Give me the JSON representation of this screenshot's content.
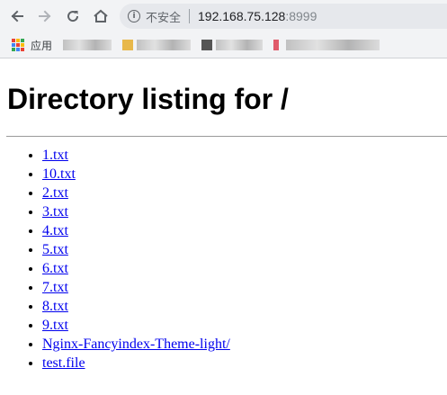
{
  "browser": {
    "address": {
      "security_label": "不安全",
      "host": "192.168.75.128",
      "port": ":8999"
    },
    "bookmarks_bar": {
      "apps_label": "应用"
    }
  },
  "page": {
    "heading": "Directory listing for /",
    "links": [
      "1.txt",
      "10.txt",
      "2.txt",
      "3.txt",
      "4.txt",
      "5.txt",
      "6.txt",
      "7.txt",
      "8.txt",
      "9.txt",
      "Nginx-Fancyindex-Theme-light/",
      "test.file"
    ]
  },
  "colors": {
    "link": "#0000ee",
    "chrome_bg": "#f2f3f5",
    "omnibox_bg": "#e6e8ec"
  },
  "icons": {
    "back": "back-arrow-icon",
    "forward": "forward-arrow-icon",
    "reload": "reload-icon",
    "home": "home-icon",
    "info": "info-icon",
    "apps": "apps-grid-icon"
  }
}
